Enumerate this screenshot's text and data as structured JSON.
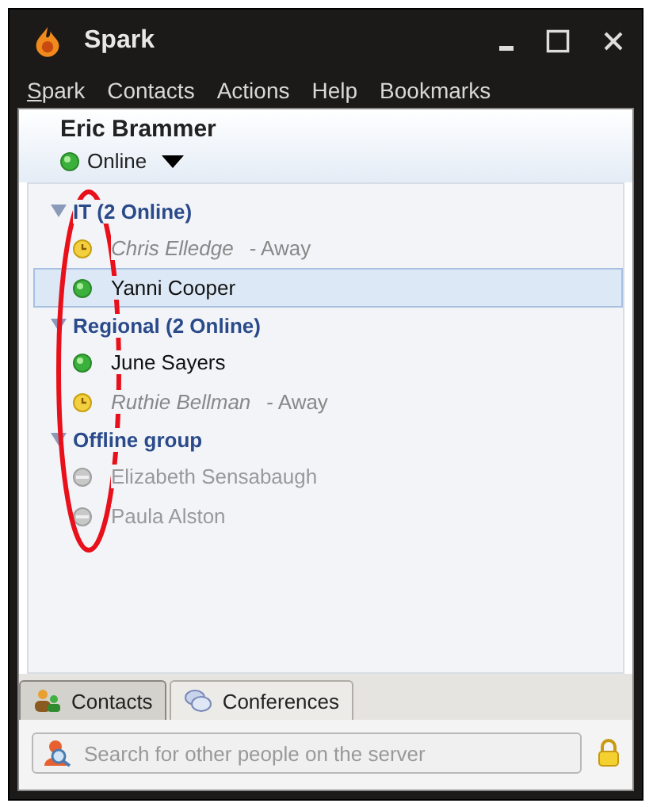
{
  "window": {
    "title": "Spark"
  },
  "menu": [
    {
      "label": "Spark",
      "mnemonic": true
    },
    {
      "label": "Contacts"
    },
    {
      "label": "Actions"
    },
    {
      "label": "Help"
    },
    {
      "label": "Bookmarks"
    }
  ],
  "profile": {
    "name": "Eric Brammer",
    "status": "Online",
    "kind": "online"
  },
  "groups": [
    {
      "name": "IT (2 Online)",
      "expanded": true,
      "contacts": [
        {
          "name": "Chris Elledge",
          "kind": "away",
          "note": "- Away",
          "selected": false
        },
        {
          "name": "Yanni Cooper",
          "kind": "online",
          "selected": true
        }
      ]
    },
    {
      "name": "Regional (2 Online)",
      "expanded": true,
      "contacts": [
        {
          "name": "June Sayers",
          "kind": "online",
          "selected": false
        },
        {
          "name": "Ruthie Bellman",
          "kind": "away",
          "note": "- Away",
          "selected": false
        }
      ]
    },
    {
      "name": "Offline group",
      "expanded": true,
      "contacts": [
        {
          "name": "Elizabeth Sensabaugh",
          "kind": "offline",
          "selected": false
        },
        {
          "name": "Paula Alston",
          "kind": "offline",
          "selected": false
        }
      ]
    }
  ],
  "tabs": [
    {
      "label": "Contacts",
      "selected": true
    },
    {
      "label": "Conferences",
      "selected": false
    }
  ],
  "search": {
    "placeholder": "Search for other people on the server"
  }
}
